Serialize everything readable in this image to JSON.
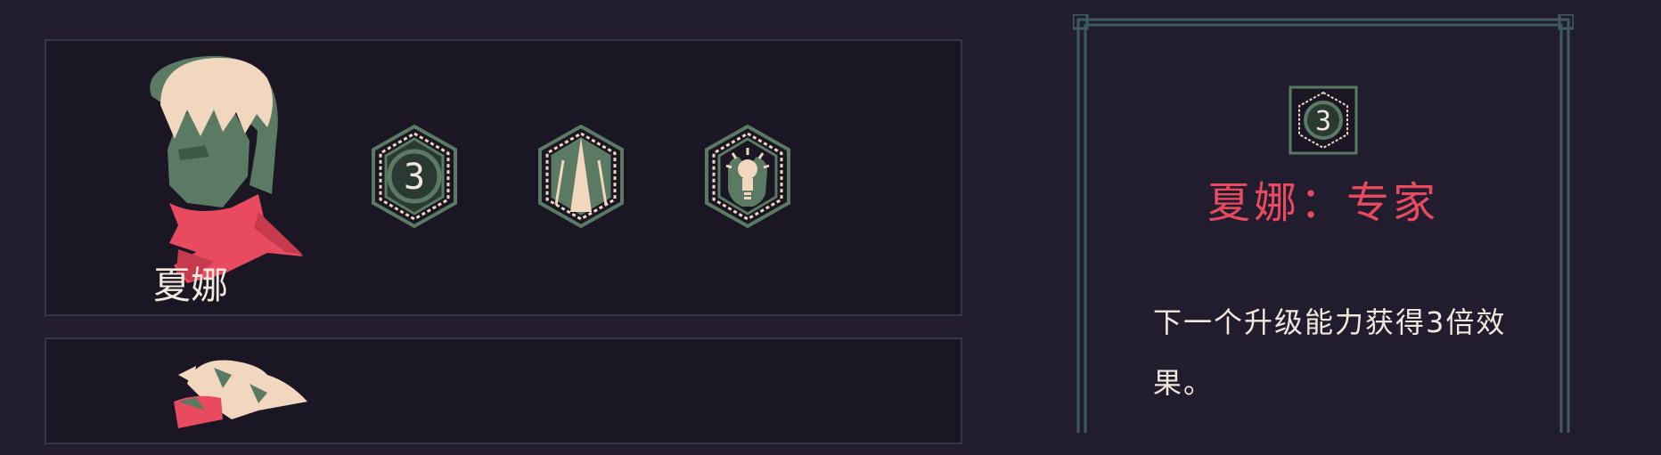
{
  "colors": {
    "background": "#221d2e",
    "card_background": "#1a1624",
    "card_border": "#323747",
    "accent_red": "#e84a5f",
    "cream": "#f2e7dc",
    "sage_green": "#5b7a63",
    "panel_border": "#3e5a63"
  },
  "characters": [
    {
      "name": "夏娜",
      "portrait_icon": "character-portrait-shana",
      "abilities": [
        {
          "icon": "number-three-hex-icon",
          "selected": true
        },
        {
          "icon": "spire-hex-icon",
          "selected": false
        },
        {
          "icon": "lightbulb-hex-icon",
          "selected": false
        }
      ]
    },
    {
      "name": "",
      "portrait_icon": "character-portrait-blonde",
      "abilities": []
    }
  ],
  "detail": {
    "icon": "number-three-hex-icon",
    "title": "夏娜：专家",
    "description": "下一个升级能力获得3倍效果。"
  }
}
